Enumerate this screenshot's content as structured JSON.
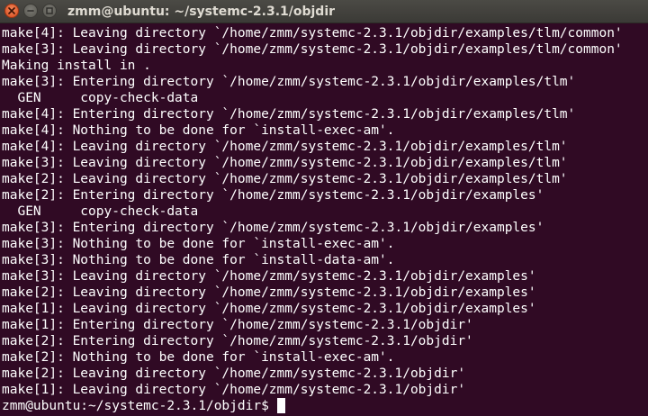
{
  "window": {
    "title": "zmm@ubuntu: ~/systemc-2.3.1/objdir"
  },
  "terminal": {
    "lines": [
      "make[4]: Leaving directory `/home/zmm/systemc-2.3.1/objdir/examples/tlm/common'",
      "make[3]: Leaving directory `/home/zmm/systemc-2.3.1/objdir/examples/tlm/common'",
      "Making install in .",
      "make[3]: Entering directory `/home/zmm/systemc-2.3.1/objdir/examples/tlm'",
      "  GEN     copy-check-data",
      "make[4]: Entering directory `/home/zmm/systemc-2.3.1/objdir/examples/tlm'",
      "make[4]: Nothing to be done for `install-exec-am'.",
      "make[4]: Leaving directory `/home/zmm/systemc-2.3.1/objdir/examples/tlm'",
      "make[3]: Leaving directory `/home/zmm/systemc-2.3.1/objdir/examples/tlm'",
      "make[2]: Leaving directory `/home/zmm/systemc-2.3.1/objdir/examples/tlm'",
      "make[2]: Entering directory `/home/zmm/systemc-2.3.1/objdir/examples'",
      "  GEN     copy-check-data",
      "make[3]: Entering directory `/home/zmm/systemc-2.3.1/objdir/examples'",
      "make[3]: Nothing to be done for `install-exec-am'.",
      "make[3]: Nothing to be done for `install-data-am'.",
      "make[3]: Leaving directory `/home/zmm/systemc-2.3.1/objdir/examples'",
      "make[2]: Leaving directory `/home/zmm/systemc-2.3.1/objdir/examples'",
      "make[1]: Leaving directory `/home/zmm/systemc-2.3.1/objdir/examples'",
      "make[1]: Entering directory `/home/zmm/systemc-2.3.1/objdir'",
      "make[2]: Entering directory `/home/zmm/systemc-2.3.1/objdir'",
      "make[2]: Nothing to be done for `install-exec-am'.",
      "make[2]: Leaving directory `/home/zmm/systemc-2.3.1/objdir'",
      "make[1]: Leaving directory `/home/zmm/systemc-2.3.1/objdir'"
    ],
    "prompt": "zmm@ubuntu:~/systemc-2.3.1/objdir$",
    "colors": {
      "background": "#300a24",
      "text": "#ffffff"
    }
  },
  "icons": [
    "close-icon",
    "minimize-icon",
    "maximize-icon"
  ]
}
